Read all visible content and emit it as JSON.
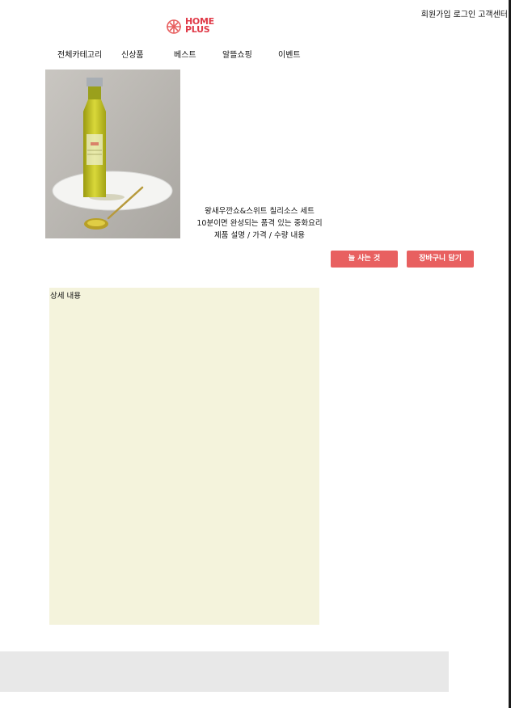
{
  "top_links": {
    "signup": "회원가입",
    "login": "로그인",
    "customer_center": "고객센터"
  },
  "logo": {
    "line1": "HOME",
    "line2": "PLUS"
  },
  "nav": {
    "items": [
      "전체카테고리",
      "신상품",
      "베스트",
      "알뜰쇼핑",
      "이벤트"
    ]
  },
  "product": {
    "name": "왕새우깐쇼&스위트 칠리소스 세트",
    "tagline": "10분이면 완성되는 품격 있는 중화요리",
    "meta": "제품 설명 / 가격 / 수량 내용"
  },
  "actions": {
    "buy_now": "늘 사는 것",
    "add_to_cart": "장바구니 담기"
  },
  "detail": {
    "label": "상세 내용"
  },
  "colors": {
    "accent": "#e86060",
    "detail_bg": "#f4f3dc",
    "footer_bg": "#e8e8e8"
  }
}
